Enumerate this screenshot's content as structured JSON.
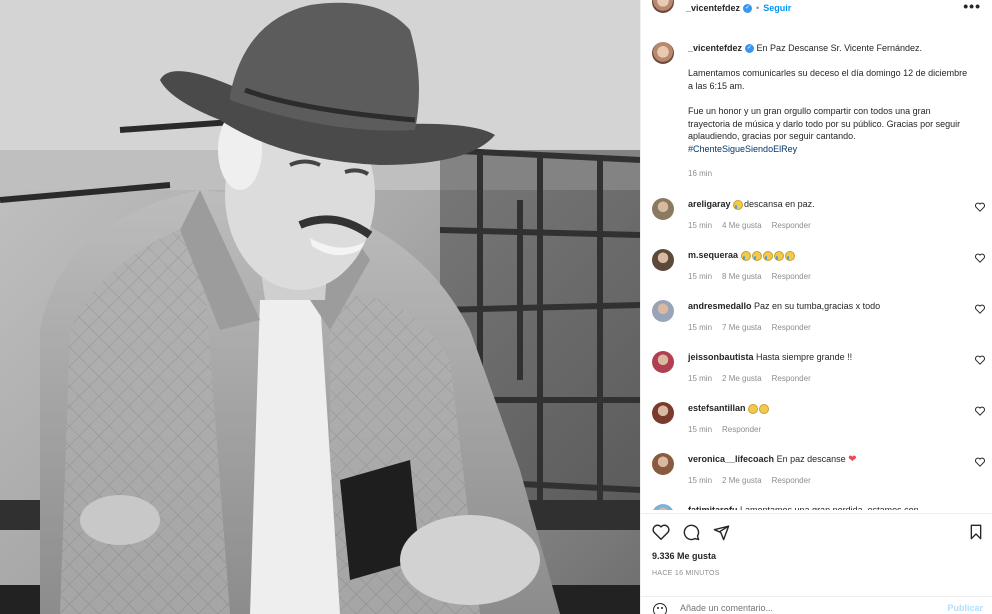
{
  "post": {
    "author": "_vicentefdez",
    "dot": "•",
    "follow_label": "Seguir",
    "more_label": "•••"
  },
  "caption": {
    "author": "_vicentefdez",
    "first_line": "En Paz Descanse Sr. Vicente Fernández.",
    "paragraph2": "Lamentamos comunicarles su deceso el día domingo 12 de diciembre a las 6:15 am.",
    "paragraph3": "Fue un honor y un gran orgullo compartir con todos una gran trayectoria de música y darlo todo por su público. Gracias por seguir aplaudiendo, gracias por seguir cantando.",
    "hashtag": "#ChenteSigueSiendoElRey",
    "time": "16 min"
  },
  "comments": [
    {
      "user": "areligaray",
      "text": "descansa en paz.",
      "emoji_before": [
        "cry"
      ],
      "time": "15 min",
      "likes": "4 Me gusta",
      "reply": "Responder",
      "avatar_color": "#8a7a60"
    },
    {
      "user": "m.sequeraa",
      "text": "",
      "emoji_before": [
        "cry",
        "cry",
        "cry",
        "cry",
        "cry"
      ],
      "time": "15 min",
      "likes": "8 Me gusta",
      "reply": "Responder",
      "avatar_color": "#5b4a3a"
    },
    {
      "user": "andresmedallo",
      "text": "Paz en su tumba,gracias x todo",
      "emoji_before": [],
      "time": "15 min",
      "likes": "7 Me gusta",
      "reply": "Responder",
      "avatar_color": "#9aa4b8"
    },
    {
      "user": "jeissonbautista",
      "text": "Hasta siempre grande !!",
      "emoji_before": [],
      "time": "15 min",
      "likes": "2 Me gusta",
      "reply": "Responder",
      "avatar_color": "#b04050"
    },
    {
      "user": "estefsantillan",
      "text": "",
      "emoji_before": [
        "sad",
        "sad"
      ],
      "time": "15 min",
      "likes": "",
      "reply": "Responder",
      "avatar_color": "#7a3a2e"
    },
    {
      "user": "veronica__lifecoach",
      "text": "En paz descanse",
      "emoji_before": [],
      "heart": "❤",
      "time": "15 min",
      "likes": "2 Me gusta",
      "reply": "Responder",
      "avatar_color": "#8a5a40"
    },
    {
      "user": "fatimitarofu",
      "text": "Lamentamos una gran perdida, estamos con",
      "emoji_before": [],
      "time": "",
      "likes": "",
      "reply": "",
      "avatar_color": "#7fb3d5"
    }
  ],
  "actions": {
    "likes": "9.336 Me gusta",
    "ago": "HACE 16 MINUTOS",
    "comment_placeholder": "Añade un comentario...",
    "publish_label": "Publicar"
  },
  "icons": {
    "like": "heart-icon",
    "comment": "comment-icon",
    "share": "share-icon",
    "save": "bookmark-icon",
    "emoji": "smile-icon"
  },
  "colors": {
    "link_blue": "#0095f6",
    "hashtag": "#00376b",
    "muted": "#8e8e8e",
    "publish_disabled": "#b2dffc",
    "heart_red": "#ed4956"
  }
}
